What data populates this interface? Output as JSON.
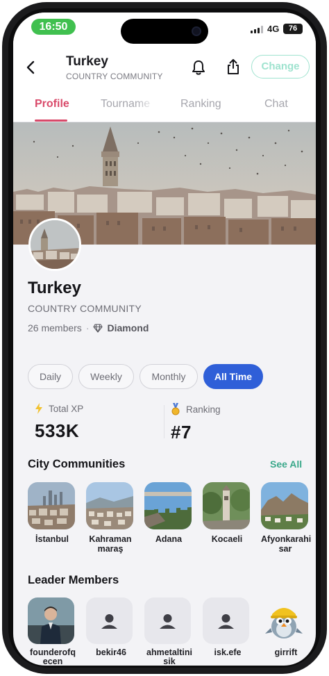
{
  "status_bar": {
    "time": "16:50",
    "network": "4G",
    "battery": "76"
  },
  "header": {
    "title": "Turkey",
    "subtitle": "COUNTRY COMMUNITY",
    "change_label": "Change"
  },
  "tabs": [
    {
      "label": "Profile"
    },
    {
      "label": "Tourname"
    },
    {
      "label": "Ranking"
    },
    {
      "label": "Chat"
    }
  ],
  "profile": {
    "name": "Turkey",
    "type": "COUNTRY COMMUNITY",
    "members": "26 members",
    "separator": "·",
    "tier": "Diamond"
  },
  "filters": [
    {
      "label": "Daily"
    },
    {
      "label": "Weekly"
    },
    {
      "label": "Monthly"
    },
    {
      "label": "All Time"
    }
  ],
  "stats": {
    "total_xp_label": "Total XP",
    "total_xp_value": "533K",
    "ranking_label": "Ranking",
    "ranking_value": "#7"
  },
  "city_section": {
    "title": "City Communities",
    "see_all": "See All"
  },
  "cities": [
    {
      "name": "İstanbul"
    },
    {
      "name": "Kahraman maraş"
    },
    {
      "name": "Adana"
    },
    {
      "name": "Kocaeli"
    },
    {
      "name": "Afyonkarahi sar"
    }
  ],
  "leader_section": {
    "title": "Leader Members"
  },
  "leaders": [
    {
      "name": "founderofq ecen"
    },
    {
      "name": "bekir46"
    },
    {
      "name": "ahmetaltini sik"
    },
    {
      "name": "isk.efe"
    },
    {
      "name": "girrift"
    }
  ],
  "colors": {
    "accent_tab": "#d94a6a",
    "filter_active": "#2f5fd8",
    "see_all": "#3aa88a",
    "change_border": "#9fe3cf",
    "time_pill": "#40c04f"
  }
}
